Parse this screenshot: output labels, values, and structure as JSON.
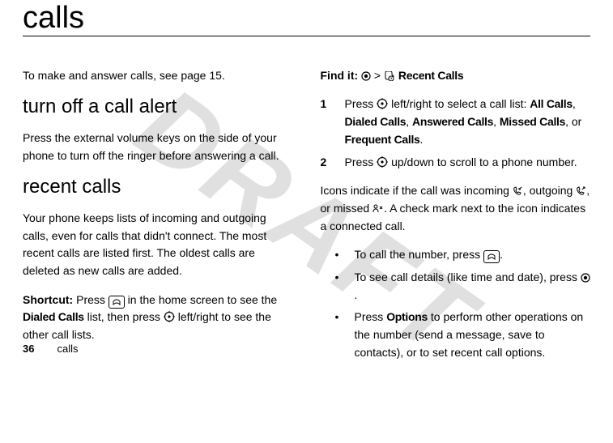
{
  "watermark": "DRAFT",
  "title": "calls",
  "left": {
    "intro": "To make and answer calls, see page 15.",
    "h2a": "turn off a call alert",
    "p_a": "Press the external volume keys on the side of your phone to turn off the ringer before answering a call.",
    "h2b": "recent calls",
    "p_b": "Your phone keeps lists of incoming and outgoing calls, even for calls that didn't connect. The most recent calls are listed first. The oldest calls are deleted as new calls are added.",
    "shortcut_label": "Shortcut:",
    "shortcut_1": " Press ",
    "shortcut_2": " in the home screen to see the ",
    "shortcut_dialed": "Dialed Calls",
    "shortcut_3": " list, then press ",
    "shortcut_4": " left/right to see the other call lists."
  },
  "right": {
    "findit_label": "Find it: ",
    "findit_gt": " > ",
    "findit_menu": "Recent Calls",
    "step1_num": "1",
    "step1_a": "Press ",
    "step1_b": " left/right to select a call list: ",
    "step1_all": "All Calls",
    "step1_c": ", ",
    "step1_dialed": "Dialed Calls",
    "step1_d": ",  ",
    "step1_answered": "Answered Calls",
    "step1_e": ",  ",
    "step1_missed": "Missed Calls",
    "step1_f": ",  or ",
    "step1_frequent": "Frequent Calls",
    "step1_g": ".",
    "step2_num": "2",
    "step2_a": "Press ",
    "step2_b": " up/down to scroll to a phone number.",
    "icons_a": "Icons indicate if the call was incoming ",
    "icons_b": ", outgoing ",
    "icons_c": ", or missed ",
    "icons_d": ". A check mark next to the icon indicates a connected call.",
    "bul1_a": "To call the number, press ",
    "bul1_b": ".",
    "bul2_a": "To see call details (like time and date), press ",
    "bul2_b": ".",
    "bul3_a": "Press ",
    "bul3_options": "Options",
    "bul3_b": " to perform other operations on the number (send a message, save to contacts), or to set recent call options."
  },
  "footer": {
    "page": "36",
    "section": "calls"
  },
  "icons": {
    "center_key": "center-key-icon",
    "recent_calls": "recent-calls-icon",
    "nav_key": "nav-key-icon",
    "send_key": "send-key-icon",
    "incoming": "incoming-call-icon",
    "outgoing": "outgoing-call-icon",
    "missed": "missed-call-icon"
  }
}
